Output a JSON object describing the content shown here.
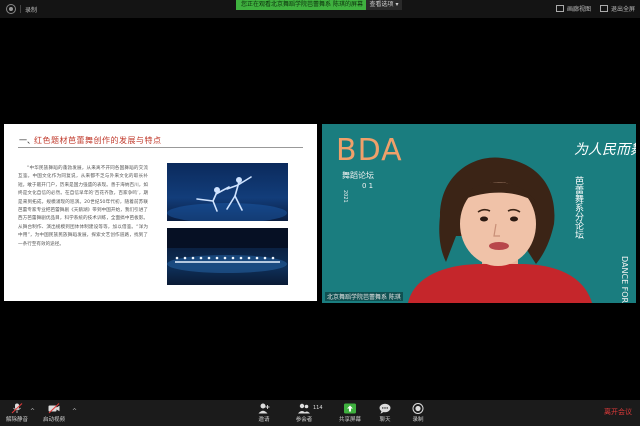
{
  "topbar": {
    "recording_label": "录制",
    "share_banner": "您正在观看北京舞蹈学院芭蕾舞系 陈琪的屏幕",
    "view_options": "查看选项",
    "gallery_view": "画廊视图",
    "exit_fullscreen": "退出全屏"
  },
  "slide": {
    "number": "一、",
    "title": "红色题材芭蕾舞创作的发展与特点",
    "body": "“中华民族舞蹈的蓬勃发展，从来离不开同各国舞蹈的交流互鉴。中国文化作为同复说，从来都不乏与外来文化的取长补短。敢于敞开门户，历来是国力强盛的表现。善于海纳百川，如终是文化自信的必然。在自信早年的‘百花齐放，百家争鸣’，期是来到拓成，规模涌现的巡演。20世纪50年代初，随着前苏联芭蕾专家专业把芭蕾舞剧《天鹅湖》带到中国开始，我们引进了西方芭蕾舞剧优品目，科学系统的技术训练，全面搞中芭板影。从舞台制作、演出规模到团体体制建设等等，加以借鉴。“洋为中用”，为中国民族民族舞蹈发展，探索文艺创作道路，找到了一条行至有效的途径。"
  },
  "speaker": {
    "name_tag": "北京舞蹈学院芭蕾舞系 陈琪",
    "bg_logo": "BDA",
    "bg_forum": "舞蹈论坛",
    "bg_year": "2021",
    "bg_number": "0 1",
    "bg_side_text": "DANCE FORUM",
    "bg_calligraphy": "为人民而舞",
    "bg_subtitle": "芭蕾舞系分论坛"
  },
  "toolbar": {
    "mute": "解除静音",
    "video": "启动视频",
    "invite": "邀请",
    "participants": "参会者",
    "participant_count": "114",
    "share": "共享屏幕",
    "chat": "聊天",
    "record": "录制",
    "leave": "离开会议"
  },
  "colors": {
    "accent_green": "#3fb13f",
    "slide_title_red": "#c0392b",
    "leave_red": "#e03a3a",
    "video_teal": "#1a7d7f"
  }
}
